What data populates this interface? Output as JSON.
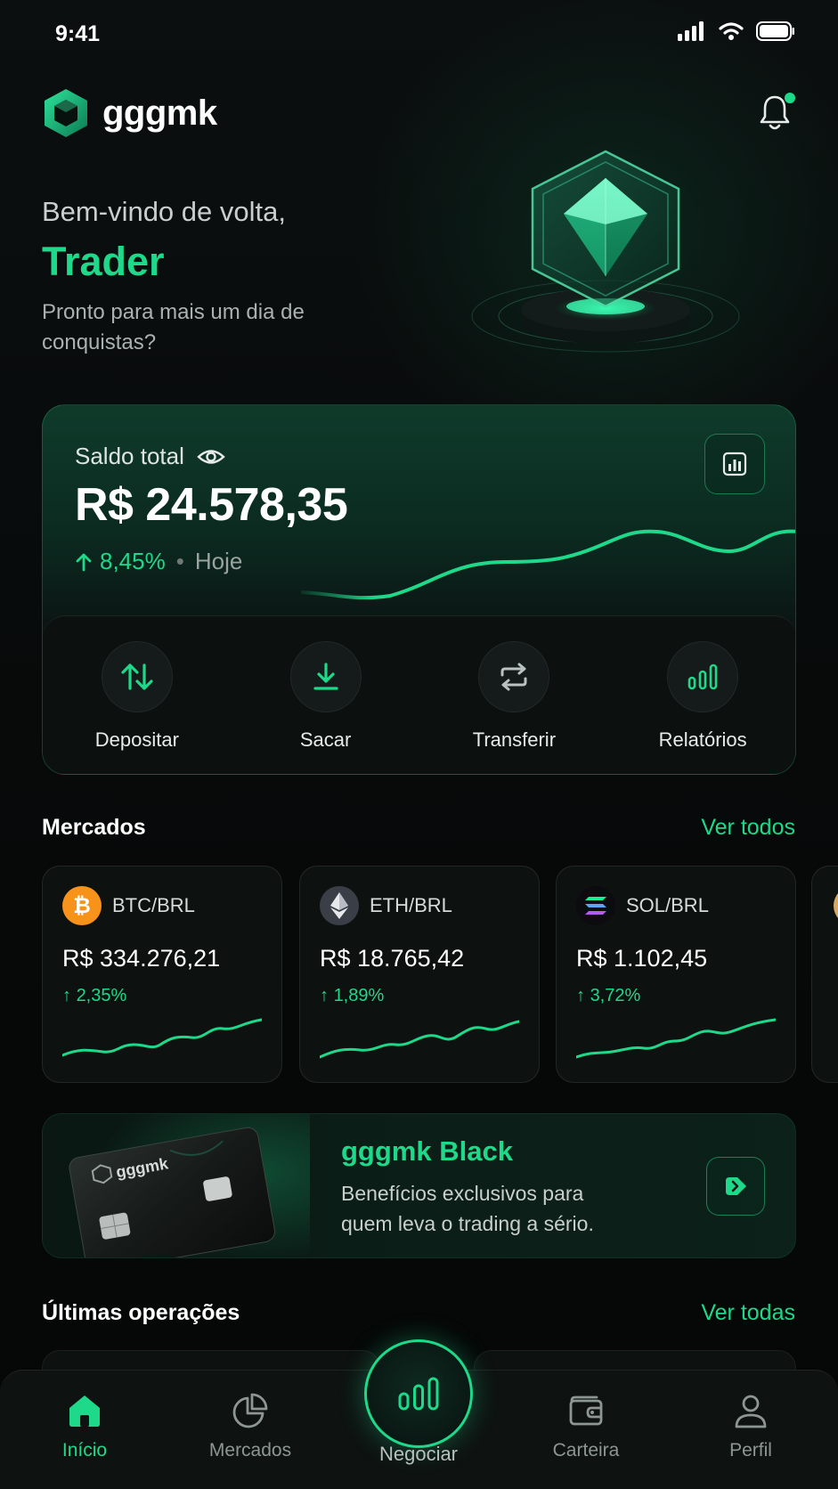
{
  "status_bar": {
    "time": "9:41"
  },
  "header": {
    "logo_text": "gggmk"
  },
  "hero": {
    "greeting": "Bem-vindo de volta,",
    "name": "Trader",
    "subtitle": "Pronto para mais um dia de conquistas?"
  },
  "balance": {
    "label": "Saldo total",
    "value": "R$ 24.578,35",
    "change": "8,45%",
    "period": "Hoje"
  },
  "actions": [
    {
      "label": "Depositar",
      "icon": "deposit-arrows-icon"
    },
    {
      "label": "Sacar",
      "icon": "download-icon"
    },
    {
      "label": "Transferir",
      "icon": "transfer-icon"
    },
    {
      "label": "Relatórios",
      "icon": "bar-chart-icon"
    }
  ],
  "markets": {
    "title": "Mercados",
    "link": "Ver todos",
    "items": [
      {
        "pair": "BTC/BRL",
        "price": "R$ 334.276,21",
        "change": "2,35%",
        "icon": "bitcoin-icon",
        "color": "#f7931a"
      },
      {
        "pair": "ETH/BRL",
        "price": "R$ 18.765,42",
        "change": "1,89%",
        "icon": "ethereum-icon",
        "color": "#3a3f47"
      },
      {
        "pair": "SOL/BRL",
        "price": "R$ 1.102,45",
        "change": "3,72%",
        "icon": "solana-icon",
        "color": "#0b0b10"
      }
    ]
  },
  "promo": {
    "title": "gggmk Black",
    "description": "Benefícios exclusivos para quem leva o trading a sério.",
    "card_brand": "gggmk"
  },
  "operations": {
    "title": "Últimas operações",
    "link": "Ver todas"
  },
  "nav": {
    "items": [
      {
        "label": "Início",
        "icon": "home-icon",
        "active": true
      },
      {
        "label": "Mercados",
        "icon": "pie-chart-icon",
        "active": false
      },
      {
        "label": "Negociar",
        "icon": "bar-chart-icon",
        "active": false
      },
      {
        "label": "Carteira",
        "icon": "wallet-icon",
        "active": false
      },
      {
        "label": "Perfil",
        "icon": "user-icon",
        "active": false
      }
    ]
  },
  "colors": {
    "accent": "#1ed98a",
    "background": "#07090a"
  }
}
